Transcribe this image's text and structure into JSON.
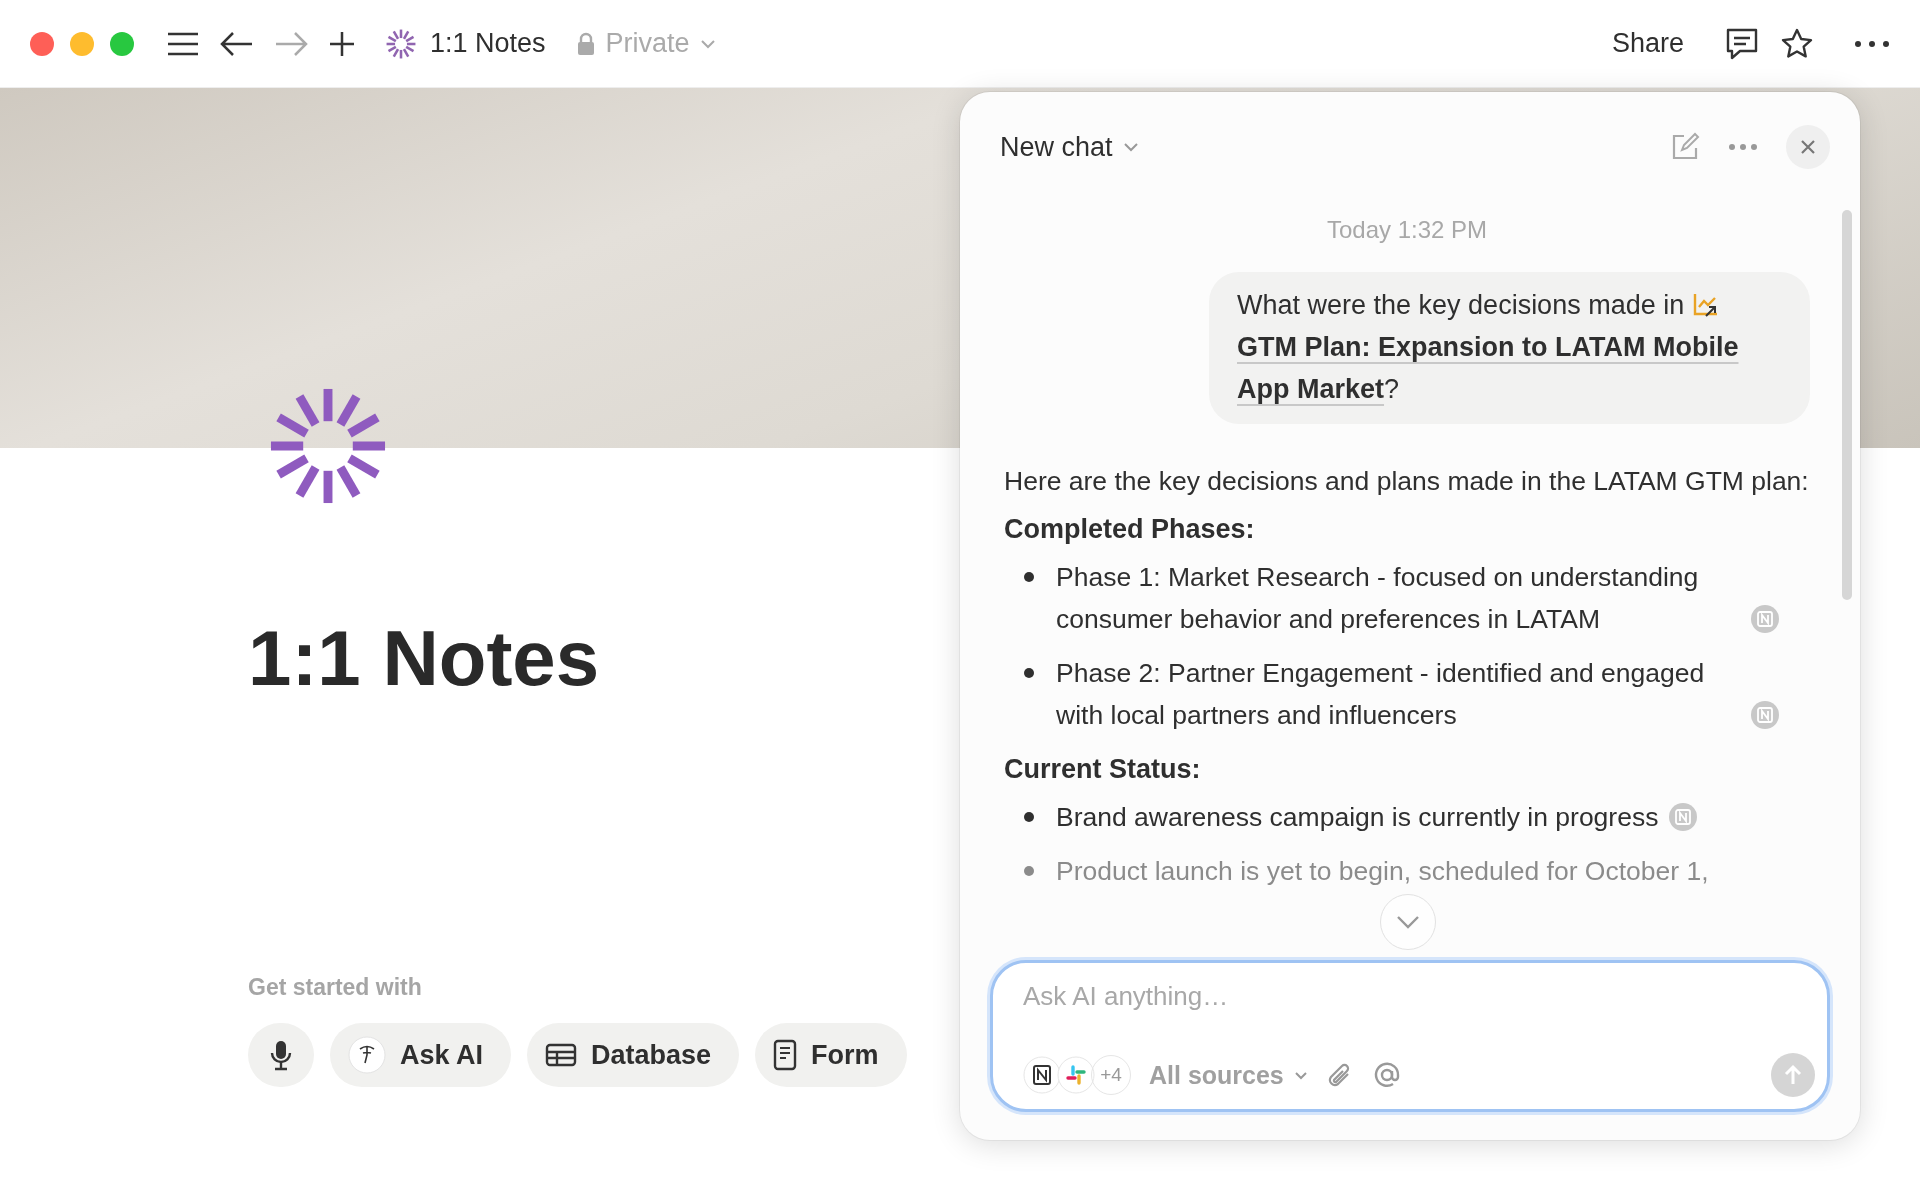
{
  "toolbar": {
    "page_title": "1:1 Notes",
    "privacy": "Private",
    "share": "Share",
    "forward_enabled": false
  },
  "page": {
    "title": "1:1 Notes",
    "get_started_label": "Get started with",
    "quick_actions": [
      {
        "kind": "voice"
      },
      {
        "kind": "ai",
        "label": "Ask AI"
      },
      {
        "kind": "database",
        "label": "Database"
      },
      {
        "kind": "form",
        "label": "Form"
      }
    ]
  },
  "chat": {
    "title": "New chat",
    "timestamp": "Today 1:32 PM",
    "user_message": {
      "text": "What were the key decisions made in",
      "mention": "GTM Plan: Expansion to LATAM Mobile App Market",
      "suffix": "?"
    },
    "response": {
      "intro": "Here are the key decisions and plans made in the LATAM GTM plan:",
      "sections": [
        {
          "heading": "Completed Phases:",
          "bullets": [
            {
              "text": "Phase 1: Market Research - focused on understanding consumer behavior and preferences in LATAM",
              "cited": true
            },
            {
              "text": "Phase 2: Partner Engagement - identified and engaged with local partners and influencers",
              "cited": true
            }
          ]
        },
        {
          "heading": "Current Status:",
          "bullets": [
            {
              "text": "Brand awareness campaign is currently in progress",
              "cited": true
            },
            {
              "text": "Product launch is yet to begin, scheduled for October 1,",
              "cited": false
            }
          ]
        }
      ]
    },
    "input": {
      "placeholder": "Ask AI anything…",
      "source_count": "+4",
      "sources_label": "All sources"
    }
  }
}
